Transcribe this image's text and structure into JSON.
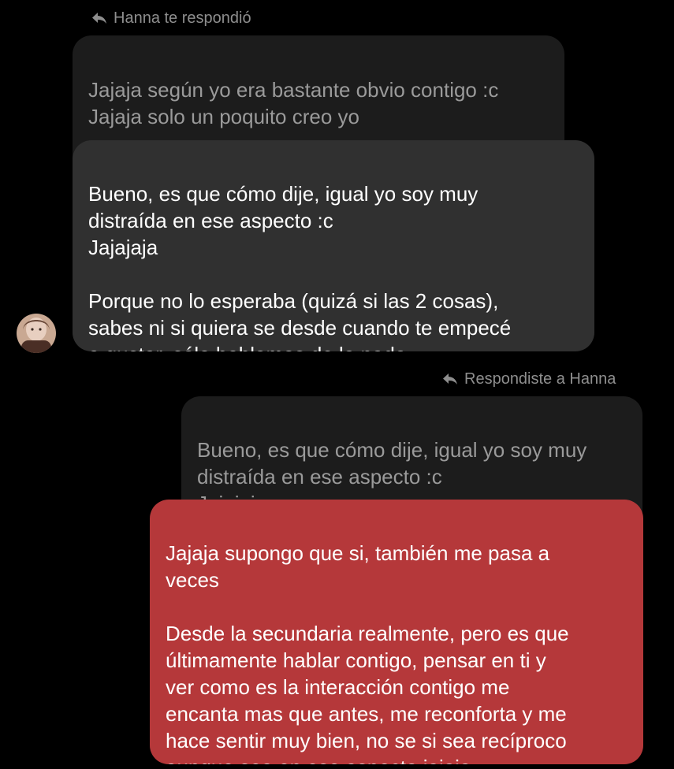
{
  "colors": {
    "background": "#000000",
    "quoted_bubble": "#1c1c1c",
    "incoming_bubble": "#303030",
    "outgoing_bubble": "#b5383a",
    "meta_text": "#8e8e8e"
  },
  "thread": {
    "incoming_reply": {
      "label": "Hanna te respondió",
      "icon": "reply-arrow-icon",
      "quoted_text": "Jajaja según yo era bastante obvio contigo :c\nJajaja solo un poquito creo yo\n…",
      "message_text": "Bueno, es que cómo dije, igual yo soy muy\ndistraída en ese aspecto :c\nJajajaja\n\nPorque no lo esperaba (quizá si las 2 cosas),\nsabes ni si quiera se desde cuando te empecé\na gustar, sólo hablamos de la nada.",
      "sender_avatar": "contact-avatar-hanna"
    },
    "outgoing_reply": {
      "label": "Respondiste a Hanna",
      "icon": "reply-arrow-icon",
      "quoted_text": "Bueno, es que cómo dije, igual yo soy muy\ndistraída en ese aspecto :c\nJajajaja…",
      "message_text": "Jajaja supongo que si, también me pasa a\nveces\n\nDesde la secundaria realmente, pero es que\núltimamente hablar contigo, pensar en ti y\nver como es la interacción contigo me\nencanta mas que antes, me reconforta y me\nhace sentir muy bien, no se si sea recíproco\naunque sea en ese aspecto jajaja"
    }
  }
}
